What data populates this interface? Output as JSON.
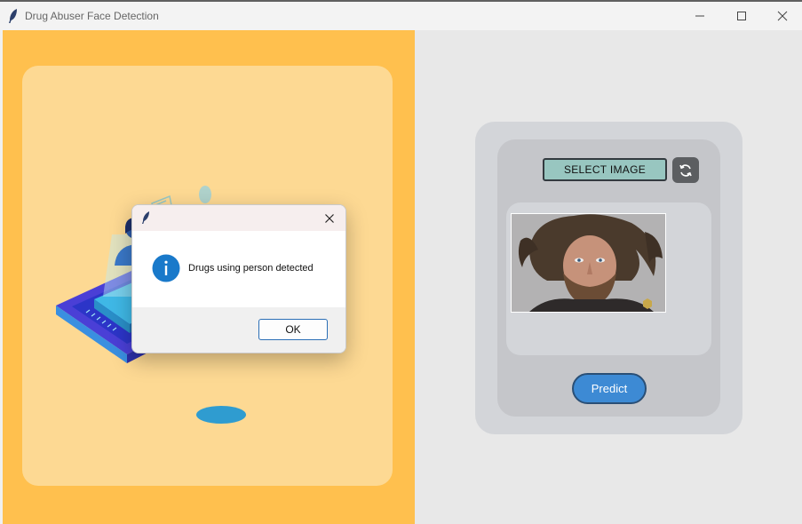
{
  "window": {
    "title": "Drug Abuser Face Detection",
    "icon": "feather-icon"
  },
  "controls": {
    "select_label": "SELECT IMAGE",
    "refresh_icon": "refresh-icon",
    "predict_label": "Predict"
  },
  "dialog": {
    "icon": "feather-icon",
    "message": "Drugs using person detected",
    "info_icon": "info-icon",
    "ok_label": "OK"
  },
  "colors": {
    "left_panel": "#ffc04e",
    "left_card": "#fdd993",
    "right_panel": "#e8e8e8",
    "select_button": "#98c6c0",
    "predict_button": "#3d8ad4",
    "info_icon": "#1979ca"
  }
}
